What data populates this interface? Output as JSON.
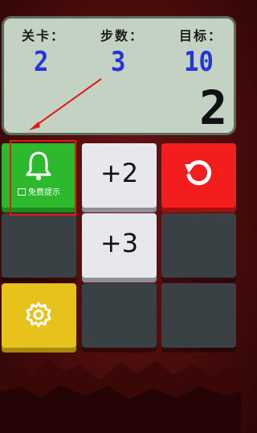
{
  "status": {
    "level_label": "关卡：",
    "level_value": "2",
    "steps_label": "步数：",
    "steps_value": "3",
    "target_label": "目标：",
    "target_value": "10",
    "current_value": "2"
  },
  "grid": {
    "hint_label": "免费提示",
    "tile_plus2": "+2",
    "tile_plus3": "+3"
  },
  "colors": {
    "hint_green": "#2eb82e",
    "undo_red": "#f21e1e",
    "settings_yellow": "#e8c21c",
    "lcd_digit_blue": "#2436d6"
  },
  "icons": {
    "hint": "bell-icon",
    "undo": "undo-icon",
    "settings": "gear-icon"
  }
}
